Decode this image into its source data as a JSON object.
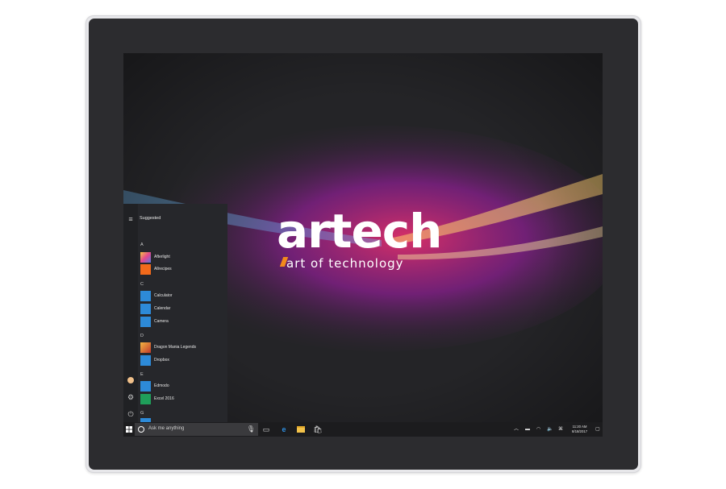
{
  "logo": {
    "wordmark": "artech",
    "tagline": "art of technology"
  },
  "start_menu": {
    "suggested_label": "Suggested",
    "groups": [
      {
        "letter": "A",
        "apps": [
          {
            "label": "Afterlight",
            "icon": "afterlight-icon",
            "color": "#d94f9a"
          },
          {
            "label": "Allrecipes",
            "icon": "allrecipes-icon",
            "color": "#f26a1b"
          }
        ]
      },
      {
        "letter": "C",
        "apps": [
          {
            "label": "Calculator",
            "icon": "calculator-icon",
            "color": "#2d8ad8"
          },
          {
            "label": "Calendar",
            "icon": "calendar-icon",
            "color": "#2d8ad8"
          },
          {
            "label": "Camera",
            "icon": "camera-icon",
            "color": "#2d8ad8"
          }
        ]
      },
      {
        "letter": "D",
        "apps": [
          {
            "label": "Dragon Mania Legends",
            "icon": "dragon-mania-icon",
            "color": "#c0392b"
          },
          {
            "label": "Dropbox",
            "icon": "dropbox-icon",
            "color": "#2d8ad8"
          }
        ]
      },
      {
        "letter": "E",
        "apps": [
          {
            "label": "Edmodo",
            "icon": "edmodo-icon",
            "color": "#2d8ad8"
          },
          {
            "label": "Excel 2016",
            "icon": "excel-icon",
            "color": "#1f9e5a"
          }
        ]
      },
      {
        "letter": "G",
        "apps": []
      }
    ]
  },
  "taskbar": {
    "search_placeholder": "Ask me anything",
    "clock_time": "11:20 AM",
    "clock_date": "8/18/2017"
  },
  "colors": {
    "accent": "#2d8ad8",
    "taskbar": "#1c1c1e",
    "start_menu": "#26272b"
  }
}
